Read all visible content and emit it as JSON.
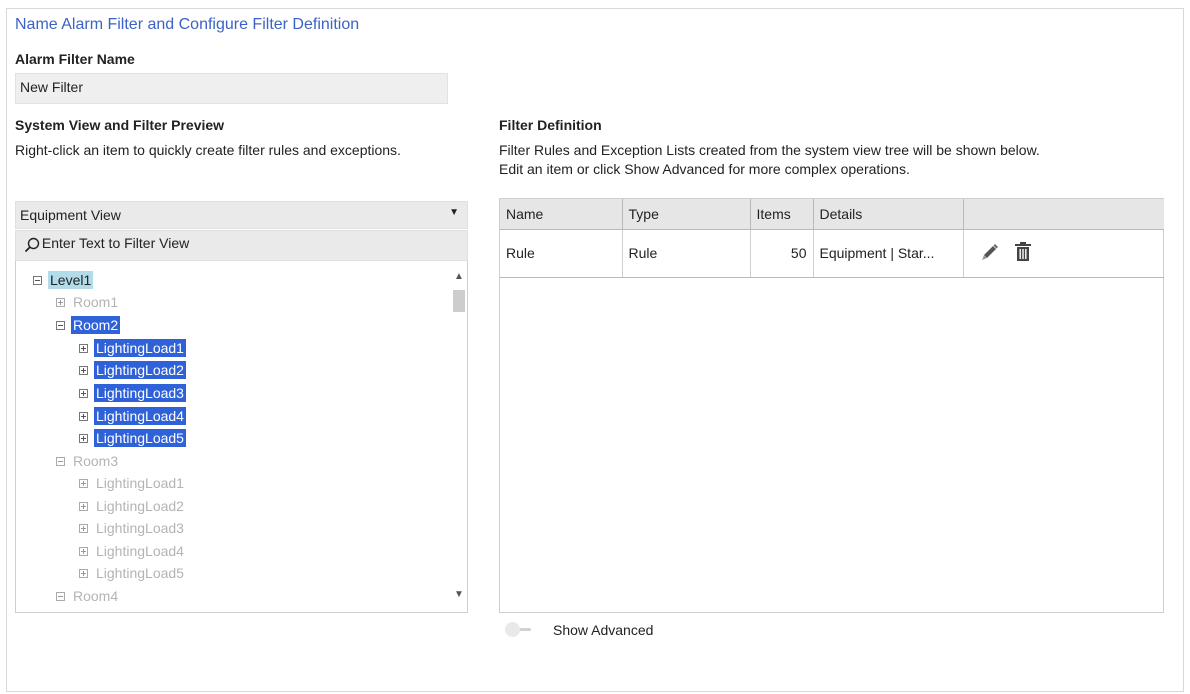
{
  "page": {
    "title": "Name Alarm Filter and Configure Filter Definition"
  },
  "filter_name": {
    "label": "Alarm Filter Name",
    "value": "New Filter"
  },
  "system_view": {
    "heading": "System View and Filter Preview",
    "description": "Right-click an item to quickly create filter rules and exceptions.",
    "view_selector": "Equipment View",
    "search_placeholder": "Enter Text to Filter View",
    "tree": [
      {
        "label": "Level1",
        "expander": "minus",
        "style": "light"
      },
      {
        "label": "Room1",
        "expander": "plus",
        "style": "dim"
      },
      {
        "label": "Room2",
        "expander": "minus",
        "style": "selected"
      },
      {
        "label": "LightingLoad1",
        "expander": "plus",
        "style": "selected"
      },
      {
        "label": "LightingLoad2",
        "expander": "plus",
        "style": "selected"
      },
      {
        "label": "LightingLoad3",
        "expander": "plus",
        "style": "selected"
      },
      {
        "label": "LightingLoad4",
        "expander": "plus",
        "style": "selected"
      },
      {
        "label": "LightingLoad5",
        "expander": "plus",
        "style": "selected"
      },
      {
        "label": "Room3",
        "expander": "minus",
        "style": "dim"
      },
      {
        "label": "LightingLoad1",
        "expander": "plus",
        "style": "dim"
      },
      {
        "label": "LightingLoad2",
        "expander": "plus",
        "style": "dim"
      },
      {
        "label": "LightingLoad3",
        "expander": "plus",
        "style": "dim"
      },
      {
        "label": "LightingLoad4",
        "expander": "plus",
        "style": "dim"
      },
      {
        "label": "LightingLoad5",
        "expander": "plus",
        "style": "dim"
      },
      {
        "label": "Room4",
        "expander": "minus",
        "style": "dim"
      }
    ]
  },
  "filter_definition": {
    "heading": "Filter Definition",
    "description_line1": "Filter Rules and Exception Lists created from the system view tree will be shown below.",
    "description_line2": "Edit an item or click Show Advanced for more complex operations.",
    "columns": [
      "Name",
      "Type",
      "Items",
      "Details",
      ""
    ],
    "rows": [
      {
        "name": "Rule",
        "type": "Rule",
        "items": "50",
        "details": "Equipment | Star..."
      }
    ]
  },
  "advanced": {
    "label": "Show Advanced",
    "enabled": false
  },
  "colors": {
    "title": "#3b63c6",
    "selection": "#2f62d8",
    "light_selection": "#b3dcea"
  }
}
